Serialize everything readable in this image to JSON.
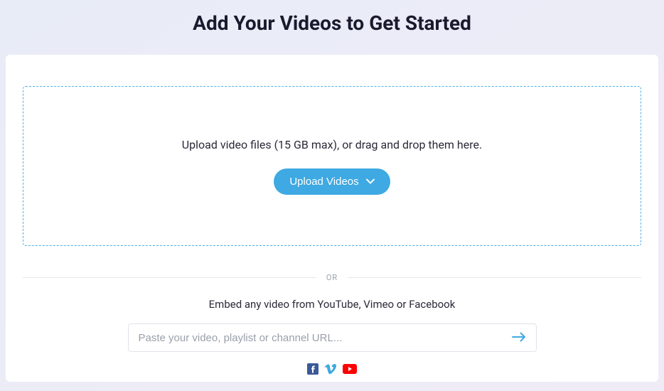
{
  "header": {
    "title": "Add Your Videos to Get Started"
  },
  "dropzone": {
    "instruction": "Upload video files (15 GB max), or drag and drop them here.",
    "button_label": "Upload Videos"
  },
  "divider": {
    "label": "OR"
  },
  "embed": {
    "instruction": "Embed any video from YouTube, Vimeo or Facebook",
    "placeholder": "Paste your video, playlist or channel URL..."
  },
  "icons": {
    "facebook": "facebook-icon",
    "vimeo": "vimeo-icon",
    "youtube": "youtube-icon"
  }
}
